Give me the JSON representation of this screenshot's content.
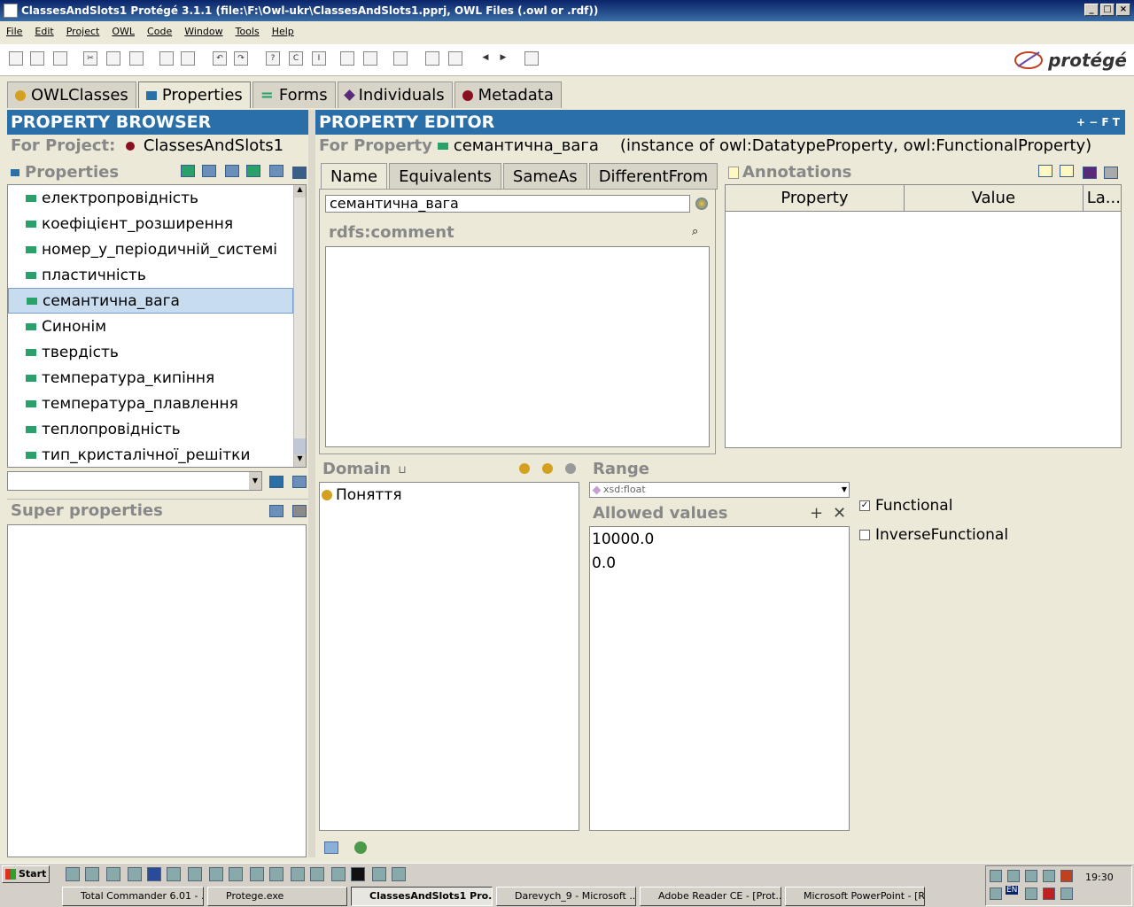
{
  "window": {
    "title": "ClassesAndSlots1  Protégé 3.1.1    (file:\\F:\\Owl-ukr\\ClassesAndSlots1.pprj, OWL Files (.owl or .rdf))"
  },
  "menu": [
    "File",
    "Edit",
    "Project",
    "OWL",
    "Code",
    "Window",
    "Tools",
    "Help"
  ],
  "logo_text": "protégé",
  "tabs": [
    {
      "label": "OWLClasses",
      "color": "#d4a020"
    },
    {
      "label": "Properties",
      "color": "#2a6fa7"
    },
    {
      "label": "Forms",
      "color": "#2aa06a"
    },
    {
      "label": "Individuals",
      "color": "#5a2a7a"
    },
    {
      "label": "Metadata",
      "color": "#8a1020"
    }
  ],
  "browser": {
    "header": "PROPERTY BROWSER",
    "project_label": "For Project:",
    "project_name": "ClassesAndSlots1",
    "properties_label": "Properties",
    "items": [
      "електропровідність",
      "коефіцієнт_розширення",
      "номер_у_періодичній_системі",
      "пластичність",
      "семантична_вага",
      "Синонім",
      "твердість",
      "температура_кипіння",
      "температура_плавлення",
      "теплопровідність",
      "тип_кристалічної_решітки"
    ],
    "selected_index": 4,
    "super_label": "Super properties"
  },
  "editor": {
    "header": "PROPERTY EDITOR",
    "header_controls": "+ − F T",
    "for_property_label": "For Property",
    "property_name": "семантична_вага",
    "instance_text": "(instance of owl:DatatypeProperty, owl:FunctionalProperty)",
    "inner_tabs": [
      "Name",
      "Equivalents",
      "SameAs",
      "DifferentFrom"
    ],
    "name_value": "семантична_вага",
    "comment_label": "rdfs:comment",
    "annotations_label": "Annotations",
    "annotation_cols": [
      "Property",
      "Value",
      "La..."
    ],
    "domain_label": "Domain",
    "domain_items": [
      "Поняття"
    ],
    "range_label": "Range",
    "range_value": "xsd:float",
    "allowed_label": "Allowed values",
    "allowed_values": [
      "10000.0",
      "0.0"
    ],
    "functional_label": "Functional",
    "functional_checked": true,
    "inverse_label": "InverseFunctional",
    "inverse_checked": false
  },
  "taskbar": {
    "start": "Start",
    "clock": "19:30",
    "lang": "EN",
    "buttons": [
      "Total Commander 6.01 - ...",
      "Protege.exe",
      "ClassesAndSlots1  Pro...",
      "Darevych_9 - Microsoft ...",
      "Adobe Reader CE - [Prot...",
      "Microsoft PowerPoint - [R..."
    ],
    "active_index": 2
  }
}
